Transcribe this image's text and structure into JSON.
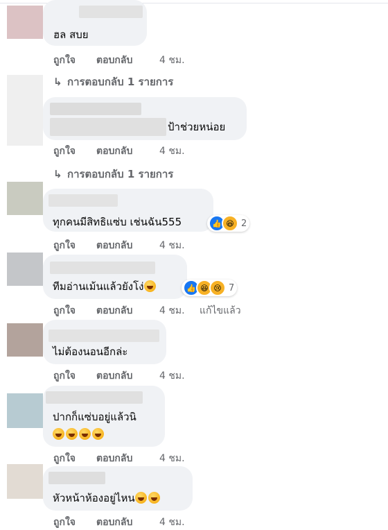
{
  "actions": {
    "like": "ถูกใจ",
    "reply": "ตอบกลับ",
    "edited": "แก้ไขแล้ว"
  },
  "comments": [
    {
      "text": "ฮล สบย",
      "time": "4 ชม.",
      "replies": "การตอบกลับ 1 รายการ"
    },
    {
      "text": "ป้าช่วยหน่อย",
      "time": "4 ชม.",
      "replies": "การตอบกลับ 1 รายการ"
    },
    {
      "text": "ทุกคนมีสิทธิแซ่บ เช่นฉัน555",
      "time": "4 ชม.",
      "reaction_count": "2"
    },
    {
      "text": "ทีมอ่านเม้นแล้วยังโง่",
      "time": "4 ชม.",
      "reaction_count": "7"
    },
    {
      "text": "ไม่ต้องนอนอีกล่ะ",
      "time": "4 ชม."
    },
    {
      "text": "ปากก็แซ่บอยู่แล้วนิ",
      "time": "4 ชม."
    },
    {
      "text": "หัวหน้าห้องอยู่ไหน",
      "time": "4 ชม."
    }
  ],
  "colors": {
    "bubble": "#f0f2f5",
    "meta": "#65676b",
    "like_blue": "#1877f2",
    "haha_yellow": "#f7b125"
  }
}
